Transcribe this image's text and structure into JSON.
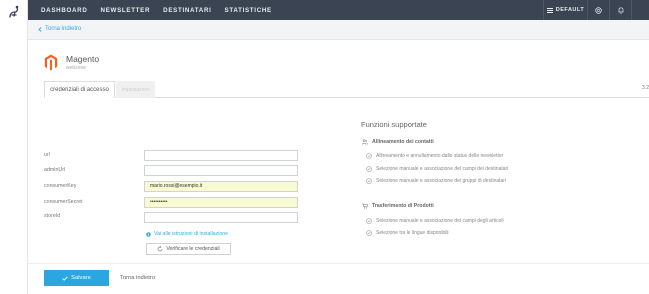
{
  "nav": {
    "items": [
      "DASHBOARD",
      "NEWSLETTER",
      "DESTINATARI",
      "STATISTICHE"
    ],
    "theme_label": "DEFAULT",
    "theme_icon": "grid-icon",
    "help_icon": "help-icon",
    "notifications_icon": "bell-icon"
  },
  "subnav": {
    "back_label": "Torna indietro"
  },
  "plugin": {
    "name": "Magento",
    "subtitle": "webzone",
    "brand_color": "#f26322"
  },
  "tabs": {
    "active": "credenziali di accesso",
    "inactive": "Impostazioni",
    "version": "3.2"
  },
  "form": {
    "fields": [
      {
        "label": "url",
        "value": ""
      },
      {
        "label": "adminUrl",
        "value": ""
      },
      {
        "label": "consumerKey",
        "value": "mario.rossi@esempio.it"
      },
      {
        "label": "consumerSecret",
        "value": "••••••••••"
      },
      {
        "label": "storeId",
        "value": ""
      }
    ],
    "help_link": "Vai alle istruzioni di installazione",
    "verify_label": "Verificare le credenziali"
  },
  "features": {
    "title": "Funzioni supportate",
    "groups": [
      {
        "title": "Allineamento dei contatti",
        "icon": "people-icon",
        "items": [
          "Allineamento e annullamento dallo status delle newsletter",
          "Selezione manuale e associazione dei campi dei destinatari",
          "Selezione manuale e associazione dei gruppi di destinatari"
        ]
      },
      {
        "title": "Trasferimento di Prodotti",
        "icon": "cart-icon",
        "items": [
          "Selezione manuale e associazione dei campi degli articoli",
          "Selezione tra le lingue disponibili"
        ]
      }
    ]
  },
  "actions": {
    "save_label": "Salvare",
    "back_label": "Torna indietro"
  },
  "colors": {
    "accent": "#2aa7e0",
    "topbar": "#3a4452",
    "autofill": "#fafad2"
  }
}
